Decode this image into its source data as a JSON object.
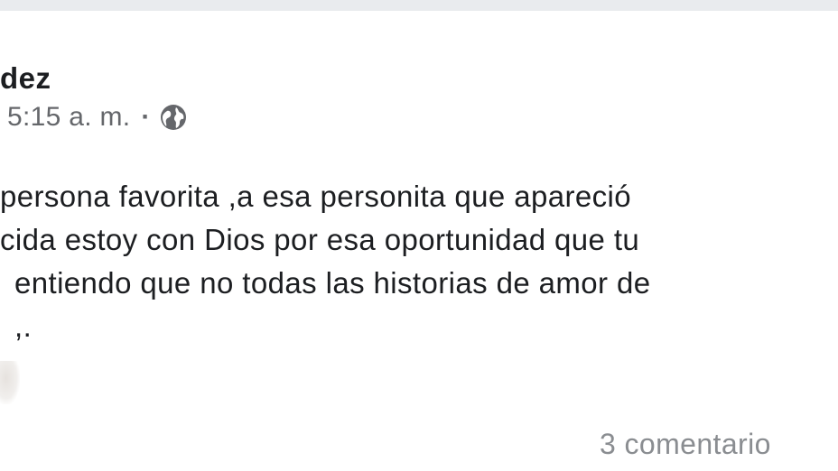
{
  "post": {
    "author_name": "dez",
    "timestamp": "5:15 a. m.",
    "separator": "·",
    "privacy_icon": "globe-icon",
    "lines": [
      "persona favorita ,a esa personita que apareció",
      "cida estoy con Dios por esa oportunidad que tu",
      "entiendo que no todas las historias de amor de",
      ",."
    ],
    "comments_label": "3 comentario"
  },
  "colors": {
    "background": "#e9ebee",
    "card": "#ffffff",
    "text": "#1c1e21",
    "secondary_text": "#65676b",
    "muted_text": "#8a8d91"
  }
}
